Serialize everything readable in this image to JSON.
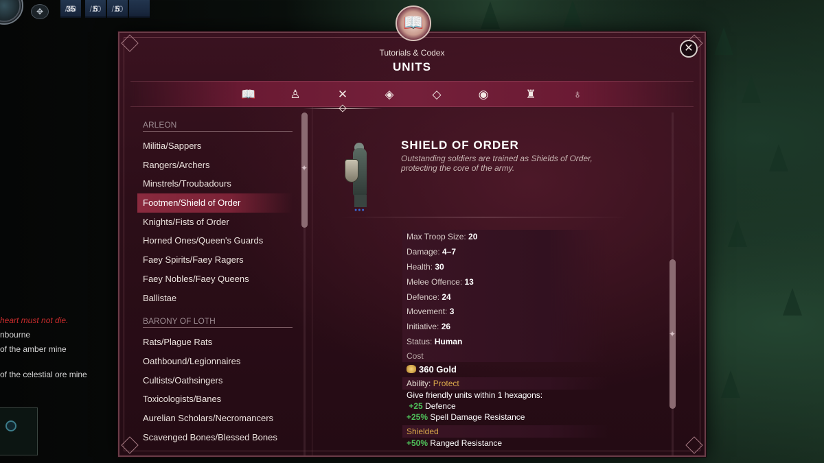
{
  "hud": {
    "stats": [
      {
        "value": "35",
        "max": "/50"
      },
      {
        "value": "5",
        "max": "/20"
      },
      {
        "value": "5",
        "max": "/20"
      }
    ]
  },
  "side_text": {
    "objective_red": "heart must not die.",
    "line1": "nbourne",
    "line2": "of the amber mine",
    "line3": "of the celestial ore mine"
  },
  "panel": {
    "subtitle": "Tutorials & Codex",
    "title": "UNITS",
    "close_label": "✕",
    "book_icon": "book-icon",
    "tabs": [
      {
        "icon": "book-icon",
        "glyph": "📖"
      },
      {
        "icon": "soldier-icon",
        "glyph": "♙"
      },
      {
        "icon": "crossed-swords-icon",
        "glyph": "✕"
      },
      {
        "icon": "diamond-rune-icon",
        "glyph": "◈"
      },
      {
        "icon": "gem-icon",
        "glyph": "◇"
      },
      {
        "icon": "sphere-icon",
        "glyph": "◉"
      },
      {
        "icon": "castle-icon",
        "glyph": "♜"
      },
      {
        "icon": "potion-icon",
        "glyph": "♁"
      }
    ],
    "active_tab": 2
  },
  "list": {
    "groups": [
      {
        "header": "ARLEON",
        "items": [
          "Militia/Sappers",
          "Rangers/Archers",
          "Minstrels/Troubadours",
          "Footmen/Shield of Order",
          "Knights/Fists of Order",
          "Horned Ones/Queen's Guards",
          "Faey Spirits/Faey Ragers",
          "Faey Nobles/Faey Queens",
          "Ballistae"
        ]
      },
      {
        "header": "BARONY OF LOTH",
        "items": [
          "Rats/Plague Rats",
          "Oathbound/Legionnaires",
          "Cultists/Oathsingers",
          "Toxicologists/Banes",
          "Aurelian Scholars/Necromancers",
          "Scavenged Bones/Blessed Bones"
        ]
      }
    ],
    "selected": "Footmen/Shield of Order"
  },
  "unit": {
    "name": "SHIELD OF ORDER",
    "description": "Outstanding soldiers are trained as Shields of Order, protecting the core of the army.",
    "stats": [
      {
        "label": "Max Troop Size",
        "value": "20"
      },
      {
        "label": "Damage",
        "value": "4–7"
      },
      {
        "label": "Health",
        "value": "30"
      },
      {
        "label": "Melee Offence",
        "value": "13"
      },
      {
        "label": "Defence",
        "value": "24"
      },
      {
        "label": "Movement",
        "value": "3"
      },
      {
        "label": "Initiative",
        "value": "26"
      },
      {
        "label": "Status",
        "value": "Human"
      }
    ],
    "cost_label": "Cost",
    "cost_value": "360 Gold",
    "ability_label": "Ability:",
    "ability_name": "Protect",
    "ability_desc": "Give friendly units within 1 hexagons:",
    "ability_bonus1_value": "+25",
    "ability_bonus1_text": " Defence",
    "ability_bonus2_value": "+25%",
    "ability_bonus2_text": " Spell Damage Resistance",
    "trait_name": "Shielded",
    "trait_bonus_value": "+50%",
    "trait_bonus_text": " Ranged Resistance"
  }
}
